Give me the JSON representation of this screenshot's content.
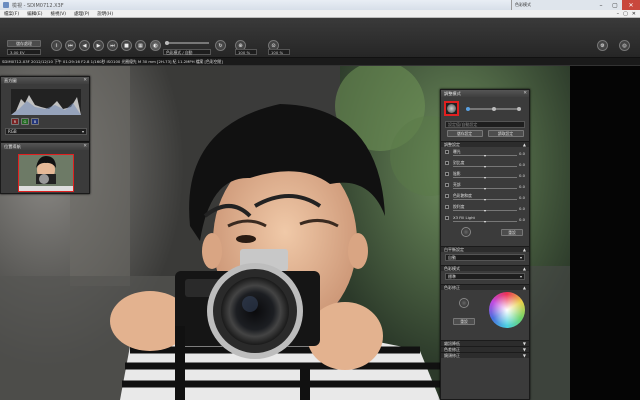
{
  "window": {
    "title": "檢視 - SDIM0712.X3F",
    "minimize": "–",
    "maximize": "▢",
    "close": "✕"
  },
  "menubar": {
    "items": [
      "檔案(F)",
      "編輯(E)",
      "檢視(V)",
      "處理(P)",
      "說明(H)"
    ],
    "right": [
      "–",
      "▢",
      "✕"
    ]
  },
  "ghost_window": {
    "title": "色彩模式"
  },
  "toolbar": {
    "save_label": "儲存處理",
    "exposure_value": "3.00 EV",
    "mode_select": "色彩模式 / 自動",
    "zoom_value": "100 %",
    "fit_value": "100 %"
  },
  "infoline": {
    "text": "SDIM0712.X3F 2012/12/10 下午 01:29:16 F2.8 1/160秒 ISO100 光圈優先 M 30 mm [2H-73] 紀 11.2MPH 檔案 [色彩空間]"
  },
  "histogram_panel": {
    "title": "直方圖",
    "select": "RGB",
    "channels": [
      "R",
      "G",
      "B"
    ]
  },
  "navigator_panel": {
    "title": "位置導航"
  },
  "adjust_panel": {
    "title": "調整模式",
    "preset_placeholder": "設定值/自動設定",
    "save_button": "儲存設定",
    "load_button": "讀取設定",
    "section_settings": "調整設定",
    "sliders": [
      {
        "label": "曝光",
        "value": "0.0"
      },
      {
        "label": "對比度",
        "value": "0.0"
      },
      {
        "label": "陰影",
        "value": "0.0"
      },
      {
        "label": "亮部",
        "value": "0.0"
      },
      {
        "label": "色彩飽和度",
        "value": "0.0"
      },
      {
        "label": "銳利度",
        "value": "0.0"
      },
      {
        "label": "X3 Fill Light",
        "value": "0.0"
      }
    ],
    "reset_button": "重設",
    "section_wb": "白平衡設定",
    "wb_select": "自動",
    "section_color_mode": "色彩模式",
    "color_mode_select": "標準",
    "section_color": "色彩修正",
    "color_reset": "重設",
    "section_noise": "雜訊降低",
    "section_fringe": "色差修正",
    "section_distort": "鏡頭修正"
  }
}
